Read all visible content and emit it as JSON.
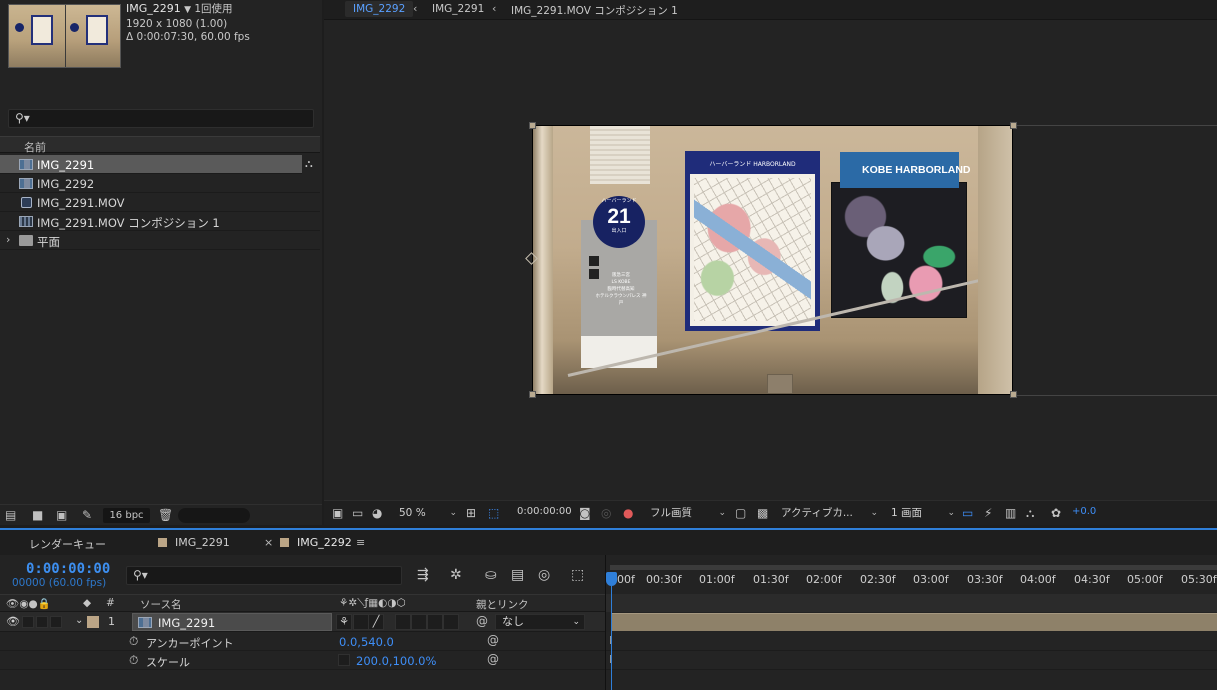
{
  "project": {
    "item_name": "IMG_2291",
    "usage": "1回使用",
    "dimensions": "1920 x 1080 (1.00)",
    "duration": "Δ 0:00:07:30, 60.00 fps",
    "search_icon": "search-icon",
    "column_name": "名前",
    "items": [
      {
        "label": "IMG_2291",
        "type": "footage",
        "selected": true
      },
      {
        "label": "IMG_2292",
        "type": "footage",
        "selected": false
      },
      {
        "label": "IMG_2291.MOV",
        "type": "movie",
        "selected": false
      },
      {
        "label": "IMG_2291.MOV コンポジション 1",
        "type": "composition",
        "selected": false
      },
      {
        "label": "平面",
        "type": "folder",
        "selected": false
      }
    ],
    "bpc": "16 bpc"
  },
  "viewer": {
    "breadcrumbs": [
      "IMG_2292",
      "IMG_2291",
      "IMG_2291.MOV コンポジション 1"
    ],
    "photo": {
      "circle_top": "ハーバーランド",
      "circle_number": "21",
      "circle_bottom": "出入口",
      "sign_text": [
        "阪急三宮",
        "LS KOBE",
        "臨時代替高知",
        "ホテルクラウンパレス 神戸"
      ],
      "map_header": "ハーバーランド HARBORLAND",
      "banner": "KOBE HARBORLAND"
    },
    "zoom": "50 %",
    "time": "0:00:00:00",
    "resolution": "フル画質",
    "camera": "アクティブカ...",
    "views": "1 画面",
    "exposure": "+0.0"
  },
  "timeline": {
    "tabs": [
      {
        "label": "レンダーキュー",
        "active": false,
        "swatch": false
      },
      {
        "label": "IMG_2291",
        "active": false,
        "swatch": true
      },
      {
        "label": "IMG_2292",
        "active": true,
        "swatch": true
      }
    ],
    "timecode": "0:00:00:00",
    "frames": "00000 (60.00 fps)",
    "ruler_ticks": [
      "00f",
      "00:30f",
      "01:00f",
      "01:30f",
      "02:00f",
      "02:30f",
      "03:00f",
      "03:30f",
      "04:00f",
      "04:30f",
      "05:00f",
      "05:30f"
    ],
    "columns": {
      "number": "#",
      "source_name": "ソース名",
      "parent_link": "親とリンク"
    },
    "layer": {
      "number": "1",
      "name": "IMG_2291",
      "parent": "なし"
    },
    "properties": [
      {
        "name": "アンカーポイント",
        "value": "0.0,540.0"
      },
      {
        "name": "スケール",
        "value": "200.0,100.0%"
      }
    ]
  },
  "colors": {
    "accent": "#2f7fd9",
    "timecode": "#3d8ff0",
    "label_tan": "#bba586",
    "selection": "#5a5a5a"
  }
}
